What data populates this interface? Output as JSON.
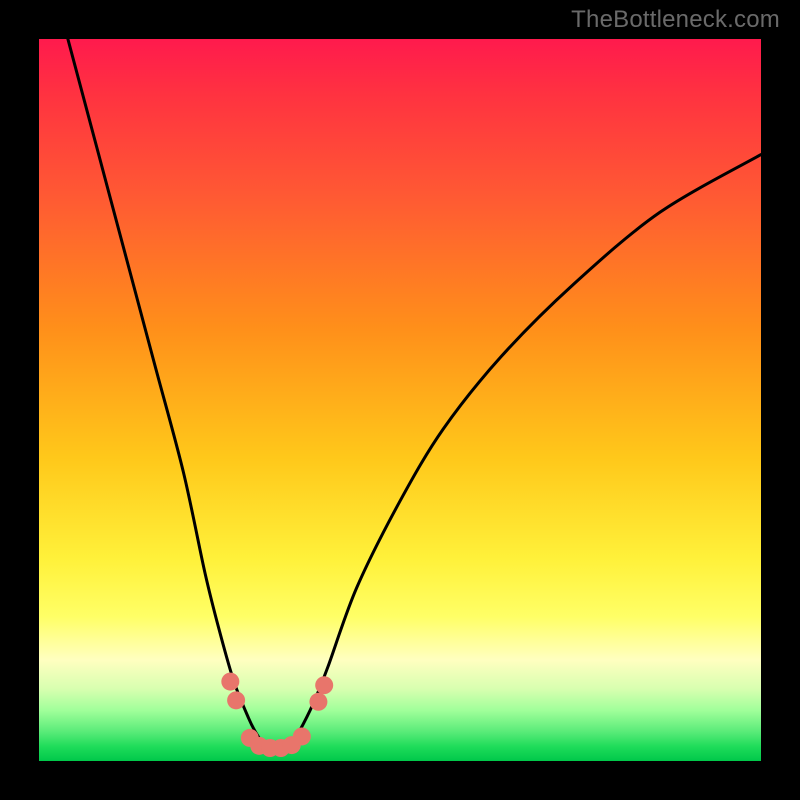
{
  "watermark": "TheBottleneck.com",
  "colors": {
    "frame": "#000000",
    "curve_stroke": "#000000",
    "marker_fill": "#e8756b",
    "gradient_top": "#ff1a4d",
    "gradient_bottom": "#00c84a"
  },
  "chart_data": {
    "type": "line",
    "title": "",
    "xlabel": "",
    "ylabel": "",
    "xlim": [
      0,
      100
    ],
    "ylim": [
      0,
      100
    ],
    "series": [
      {
        "name": "bottleneck-curve",
        "x": [
          4,
          8,
          12,
          16,
          20,
          23,
          25,
          27,
          29,
          30,
          31,
          32,
          33,
          34,
          35,
          36,
          38,
          40,
          44,
          50,
          56,
          64,
          74,
          86,
          100
        ],
        "y": [
          100,
          85,
          70,
          55,
          40,
          26,
          18,
          11,
          6,
          4,
          2.5,
          2,
          2,
          2,
          2.5,
          4,
          8,
          13,
          24,
          36,
          46,
          56,
          66,
          76,
          84
        ]
      }
    ],
    "markers": [
      {
        "x": 26.5,
        "y": 11.0
      },
      {
        "x": 27.3,
        "y": 8.4
      },
      {
        "x": 29.2,
        "y": 3.2
      },
      {
        "x": 30.5,
        "y": 2.1
      },
      {
        "x": 32.0,
        "y": 1.8
      },
      {
        "x": 33.5,
        "y": 1.8
      },
      {
        "x": 35.0,
        "y": 2.2
      },
      {
        "x": 36.4,
        "y": 3.4
      },
      {
        "x": 38.7,
        "y": 8.2
      },
      {
        "x": 39.5,
        "y": 10.5
      }
    ]
  }
}
